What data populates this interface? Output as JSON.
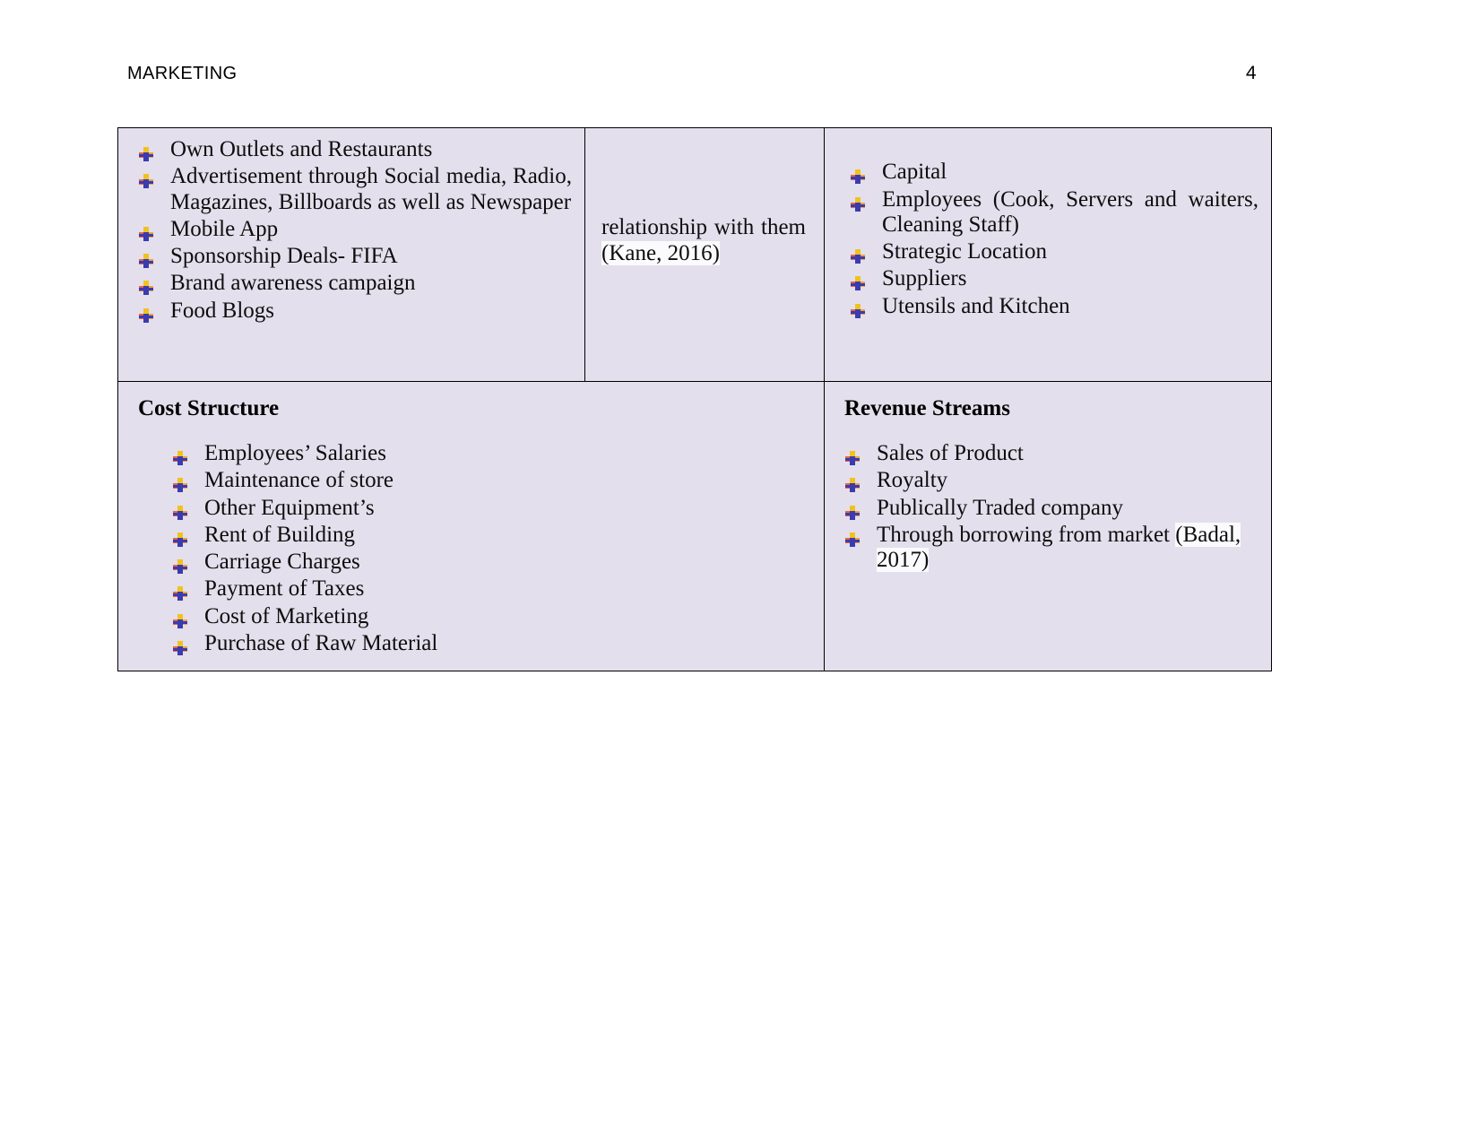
{
  "header": {
    "title": "MARKETING",
    "page_number": "4"
  },
  "colors": {
    "cell_background": "#e3dfec",
    "border": "#000000",
    "text": "#0d0d0d",
    "highlight": "#fbfbfd"
  },
  "table": {
    "top_row": {
      "channels_cell": {
        "bullet_icon": "arrow-bullet-icon",
        "items": [
          "Own Outlets and Restaurants",
          "Advertisement through Social media, Radio, Magazines, Billboards as well as Newspaper",
          "Mobile App",
          "Sponsorship Deals- FIFA",
          "Brand awareness campaign",
          "Food Blogs"
        ]
      },
      "customer_relationships_cell": {
        "text": "relationship with them ",
        "citation": "(Kane, 2016)"
      },
      "key_resources_cell": {
        "bullet_icon": "arrow-bullet-icon",
        "items": [
          "Capital",
          "Employees (Cook, Servers and waiters, Cleaning Staff)",
          "Strategic Location",
          "Suppliers",
          "Utensils and Kitchen"
        ]
      }
    },
    "bottom_row": {
      "cost_structure_cell": {
        "heading": "Cost Structure",
        "bullet_icon": "arrow-bullet-icon",
        "items": [
          "Employees’ Salaries",
          "Maintenance of store",
          "Other Equipment’s",
          "Rent of Building",
          "Carriage Charges",
          "Payment of Taxes",
          "Cost of Marketing",
          "Purchase of Raw Material"
        ]
      },
      "revenue_streams_cell": {
        "heading": "Revenue Streams",
        "bullet_icon": "arrow-bullet-icon",
        "items": [
          "Sales of Product",
          "Royalty",
          "Publically Traded company"
        ],
        "last_item_text": "Through borrowing from market ",
        "last_item_citation": "(Badal, 2017)"
      }
    }
  }
}
